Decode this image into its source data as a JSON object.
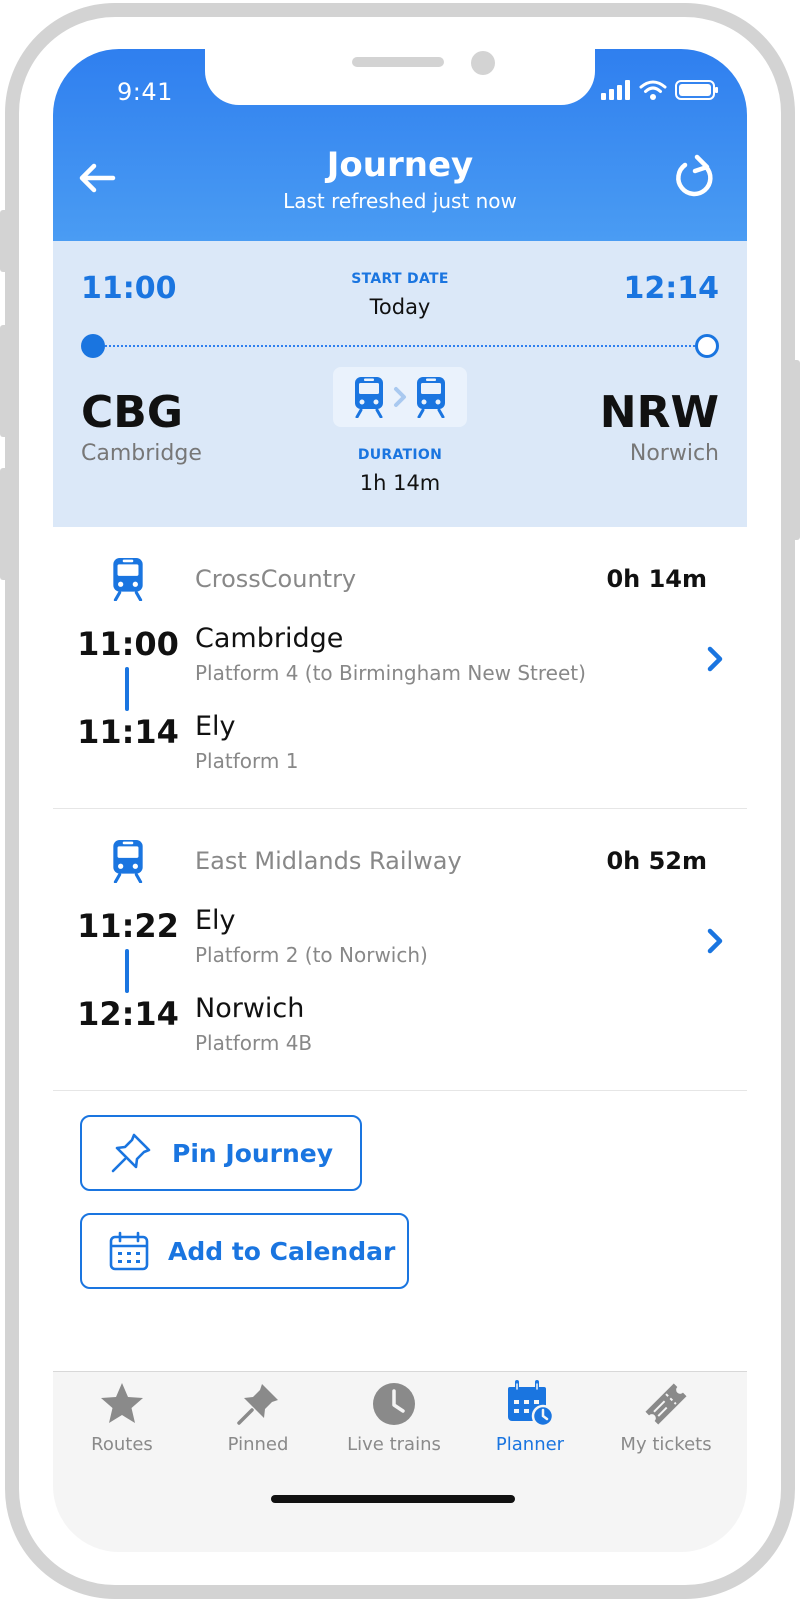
{
  "status_bar": {
    "time": "9:41"
  },
  "header": {
    "title": "Journey",
    "subtitle": "Last refreshed just now"
  },
  "summary": {
    "departure_time": "12:14",
    "departure_time_left": "11:00",
    "start_date_label": "START DATE",
    "start_date_value": "Today",
    "origin_code": "CBG",
    "origin_name": "Cambridge",
    "destination_code": "NRW",
    "destination_name": "Norwich",
    "duration_label": "DURATION",
    "duration_value": "1h 14m"
  },
  "legs": [
    {
      "operator": "CrossCountry",
      "duration": "0h 14m",
      "depart_time": "11:00",
      "depart_station": "Cambridge",
      "depart_platform": "Platform 4 (to Birmingham New Street)",
      "arrive_time": "11:14",
      "arrive_station": "Ely",
      "arrive_platform": "Platform 1"
    },
    {
      "operator": "East Midlands Railway",
      "duration": "0h 52m",
      "depart_time": "11:22",
      "depart_station": "Ely",
      "depart_platform": "Platform 2 (to Norwich)",
      "arrive_time": "12:14",
      "arrive_station": "Norwich",
      "arrive_platform": "Platform 4B"
    }
  ],
  "actions": {
    "pin_label": "Pin Journey",
    "calendar_label": "Add to Calendar"
  },
  "tabs": [
    {
      "label": "Routes",
      "icon": "star-icon"
    },
    {
      "label": "Pinned",
      "icon": "pin-icon"
    },
    {
      "label": "Live trains",
      "icon": "clock-icon"
    },
    {
      "label": "Planner",
      "icon": "calendar-clock-icon"
    },
    {
      "label": "My tickets",
      "icon": "ticket-icon"
    }
  ],
  "colors": {
    "accent": "#1a75e0",
    "header_top": "#2f7fef",
    "header_bottom": "#4a9cf3",
    "summary_bg": "#dbe8f8",
    "inactive_tab": "#8a8a8a"
  }
}
